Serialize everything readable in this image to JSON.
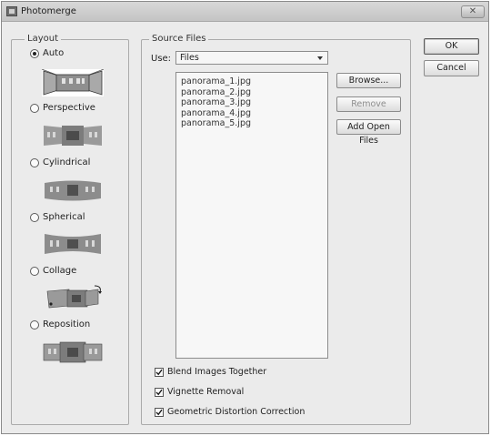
{
  "window": {
    "title": "Photomerge",
    "close_glyph": "✕"
  },
  "layout": {
    "legend": "Layout",
    "options": [
      {
        "label": "Auto",
        "checked": true,
        "thumb_icon": "auto-layout-preview-icon"
      },
      {
        "label": "Perspective",
        "checked": false,
        "thumb_icon": "perspective-layout-preview-icon"
      },
      {
        "label": "Cylindrical",
        "checked": false,
        "thumb_icon": "cylindrical-layout-preview-icon"
      },
      {
        "label": "Spherical",
        "checked": false,
        "thumb_icon": "spherical-layout-preview-icon"
      },
      {
        "label": "Collage",
        "checked": false,
        "thumb_icon": "collage-layout-preview-icon"
      },
      {
        "label": "Reposition",
        "checked": false,
        "thumb_icon": "reposition-layout-preview-icon"
      }
    ]
  },
  "source": {
    "legend": "Source Files",
    "use_label": "Use:",
    "use_value": "Files",
    "files": [
      "panorama_1.jpg",
      "panorama_2.jpg",
      "panorama_3.jpg",
      "panorama_4.jpg",
      "panorama_5.jpg"
    ],
    "buttons": {
      "browse": "Browse...",
      "remove": "Remove",
      "add_open": "Add Open Files"
    },
    "checks": [
      {
        "label": "Blend Images Together",
        "checked": true
      },
      {
        "label": "Vignette Removal",
        "checked": true
      },
      {
        "label": "Geometric Distortion Correction",
        "checked": true
      }
    ]
  },
  "actions": {
    "ok": "OK",
    "cancel": "Cancel"
  }
}
